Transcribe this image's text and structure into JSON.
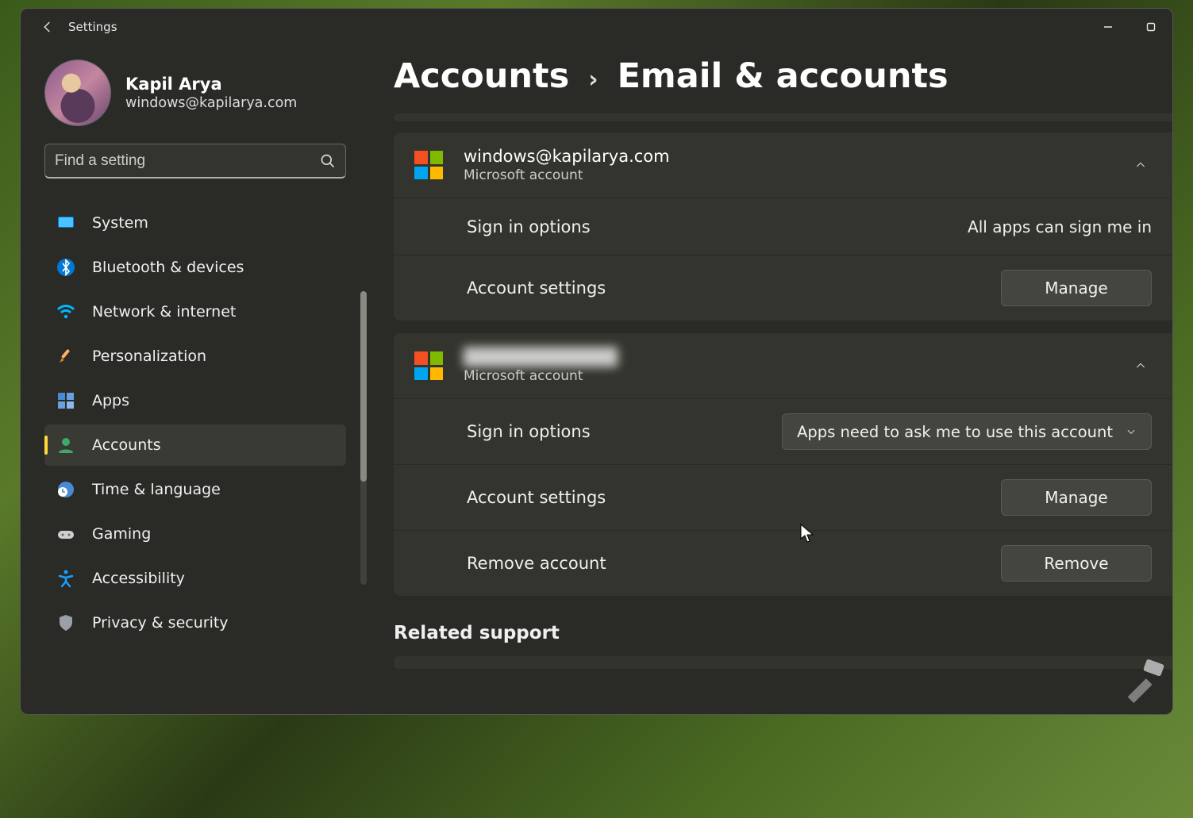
{
  "window": {
    "title": "Settings"
  },
  "profile": {
    "name": "Kapil Arya",
    "email": "windows@kapilarya.com"
  },
  "search": {
    "placeholder": "Find a setting"
  },
  "sidebar": {
    "items": [
      {
        "key": "system",
        "label": "System"
      },
      {
        "key": "bluetooth",
        "label": "Bluetooth & devices"
      },
      {
        "key": "network",
        "label": "Network & internet"
      },
      {
        "key": "personalization",
        "label": "Personalization"
      },
      {
        "key": "apps",
        "label": "Apps"
      },
      {
        "key": "accounts",
        "label": "Accounts",
        "selected": true
      },
      {
        "key": "time",
        "label": "Time & language"
      },
      {
        "key": "gaming",
        "label": "Gaming"
      },
      {
        "key": "accessibility",
        "label": "Accessibility"
      },
      {
        "key": "privacy",
        "label": "Privacy & security"
      }
    ]
  },
  "breadcrumb": {
    "root": "Accounts",
    "page": "Email & accounts"
  },
  "accounts": [
    {
      "email": "windows@kapilarya.com",
      "provider": "Microsoft account",
      "signin_label": "Sign in options",
      "signin_value": "All apps can sign me in",
      "settings_label": "Account settings",
      "manage_label": "Manage"
    },
    {
      "email": "████████████",
      "provider": "Microsoft account",
      "blurred": true,
      "signin_label": "Sign in options",
      "signin_value": "Apps need to ask me to use this account",
      "signin_dropdown": true,
      "settings_label": "Account settings",
      "manage_label": "Manage",
      "remove_label": "Remove account",
      "remove_button": "Remove"
    }
  ],
  "related_support": "Related support"
}
